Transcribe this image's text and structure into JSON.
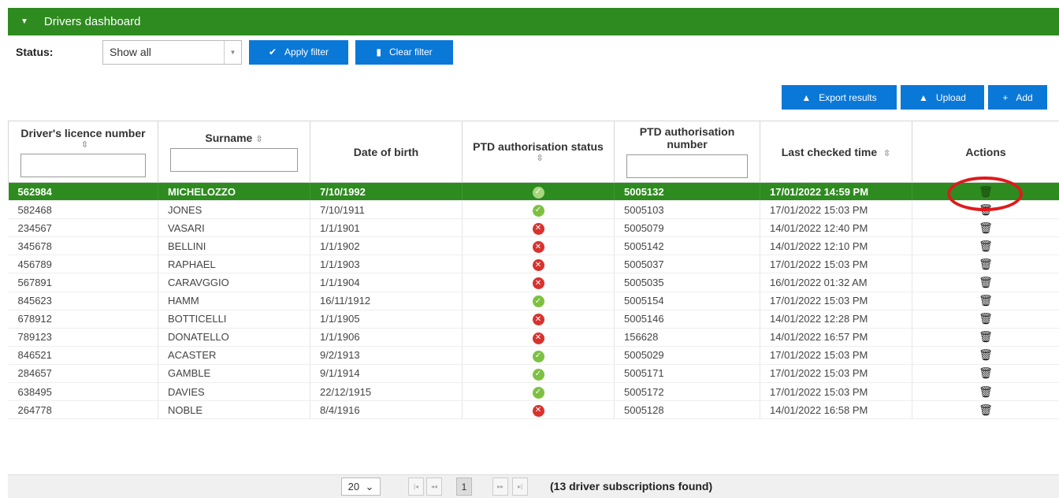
{
  "panel": {
    "title": "Drivers dashboard"
  },
  "filter": {
    "status_label": "Status:",
    "status_value": "Show all",
    "apply_label": "Apply filter",
    "clear_label": "Clear filter"
  },
  "actions": {
    "export_label": "Export results",
    "upload_label": "Upload",
    "add_label": "Add"
  },
  "columns": [
    "Driver's licence number",
    "Surname",
    "Date of birth",
    "PTD authorisation status",
    "PTD authorisation number",
    "Last checked time",
    "Actions"
  ],
  "rows": [
    {
      "licence": "562984",
      "surname": "MICHELOZZO",
      "dob": "7/10/1992",
      "status": "ok",
      "number": "5005132",
      "checked": "17/01/2022 14:59 PM"
    },
    {
      "licence": "582468",
      "surname": "JONES",
      "dob": "7/10/1911",
      "status": "ok",
      "number": "5005103",
      "checked": "17/01/2022 15:03 PM"
    },
    {
      "licence": "234567",
      "surname": "VASARI",
      "dob": "1/1/1901",
      "status": "no",
      "number": "5005079",
      "checked": "14/01/2022 12:40 PM"
    },
    {
      "licence": "345678",
      "surname": "BELLINI",
      "dob": "1/1/1902",
      "status": "no",
      "number": "5005142",
      "checked": "14/01/2022 12:10 PM"
    },
    {
      "licence": "456789",
      "surname": "RAPHAEL",
      "dob": "1/1/1903",
      "status": "no",
      "number": "5005037",
      "checked": "17/01/2022 15:03 PM"
    },
    {
      "licence": "567891",
      "surname": "CARAVGGIO",
      "dob": "1/1/1904",
      "status": "no",
      "number": "5005035",
      "checked": "16/01/2022 01:32 AM"
    },
    {
      "licence": "845623",
      "surname": "HAMM",
      "dob": "16/11/1912",
      "status": "ok",
      "number": "5005154",
      "checked": "17/01/2022 15:03 PM"
    },
    {
      "licence": "678912",
      "surname": "BOTTICELLI",
      "dob": "1/1/1905",
      "status": "no",
      "number": "5005146",
      "checked": "14/01/2022 12:28 PM"
    },
    {
      "licence": "789123",
      "surname": "DONATELLO",
      "dob": "1/1/1906",
      "status": "no",
      "number": "156628",
      "checked": "14/01/2022 16:57 PM"
    },
    {
      "licence": "846521",
      "surname": "ACASTER",
      "dob": "9/2/1913",
      "status": "ok",
      "number": "5005029",
      "checked": "17/01/2022 15:03 PM"
    },
    {
      "licence": "284657",
      "surname": "GAMBLE",
      "dob": "9/1/1914",
      "status": "ok",
      "number": "5005171",
      "checked": "17/01/2022 15:03 PM"
    },
    {
      "licence": "638495",
      "surname": "DAVIES",
      "dob": "22/12/1915",
      "status": "ok",
      "number": "5005172",
      "checked": "17/01/2022 15:03 PM"
    },
    {
      "licence": "264778",
      "surname": "NOBLE",
      "dob": "8/4/1916",
      "status": "no",
      "number": "5005128",
      "checked": "14/01/2022 16:58 PM"
    }
  ],
  "pager": {
    "page_size": "20",
    "current_page": "1",
    "count_text": "(13 driver subscriptions found)"
  },
  "colors": {
    "header_green": "#2e8b1f",
    "button_blue": "#0a78d7",
    "ok_green": "#7dc142",
    "error_red": "#d9322e",
    "highlight_red": "#e0191c"
  },
  "icons": {
    "collapse": "caret-down-icon",
    "apply": "checkmark-icon",
    "clear": "eraser-icon",
    "export": "export-icon",
    "upload": "upload-icon",
    "add": "plus-icon",
    "delete": "trash-icon",
    "ok": "check-circle-icon",
    "error": "x-circle-icon"
  }
}
